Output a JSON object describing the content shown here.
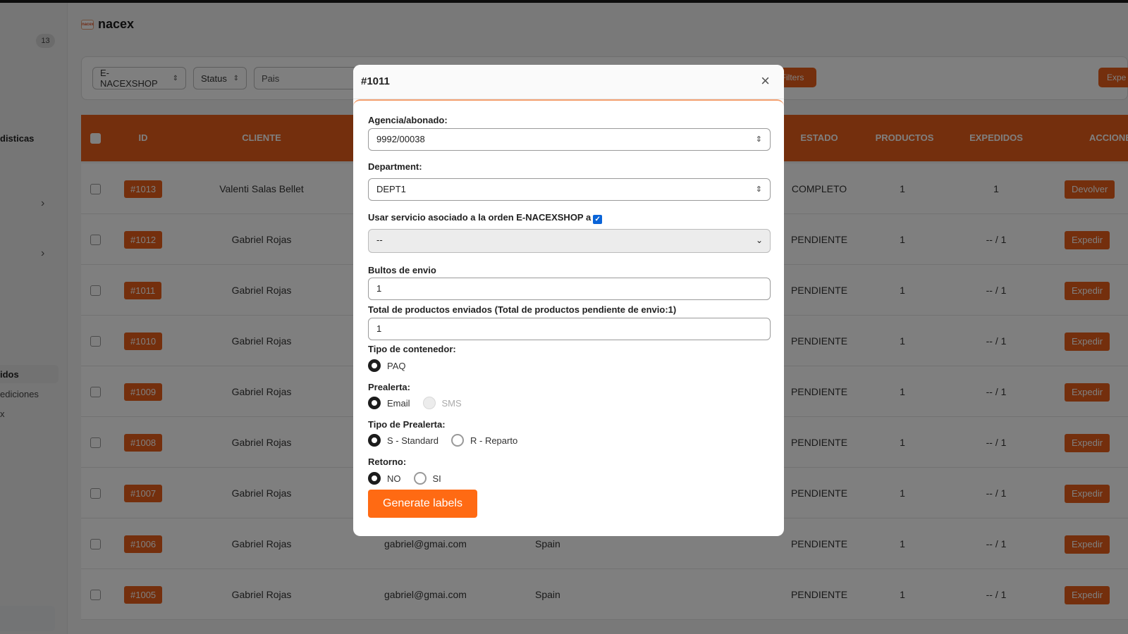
{
  "sidebar": {
    "badge": "13",
    "item_estadisticas": "disticas",
    "item_pedidos": "idos",
    "item_expediciones": "ediciones",
    "item_nacex": "x",
    "chevron": "›"
  },
  "header": {
    "logo_text": "nacex",
    "logo_mark": "nacex"
  },
  "filters": {
    "shop_select": "E-NACEXSHOP",
    "status_select": "Status",
    "country_placeholder": "Pais",
    "filters_button": "Filters",
    "expedir_button": "Expe"
  },
  "table": {
    "columns": {
      "id": "ID",
      "cliente": "CLIENTE",
      "estado": "ESTADO",
      "productos": "PRODUCTOS",
      "expedidos": "EXPEDIDOS",
      "acciones": "ACCIONE"
    },
    "rows": [
      {
        "id": "#1013",
        "cliente": "Valenti Salas Bellet",
        "email": "",
        "pais": "",
        "estado": "COMPLETO",
        "productos": "1",
        "expedidos": "1",
        "accion": "Devolver"
      },
      {
        "id": "#1012",
        "cliente": "Gabriel Rojas",
        "email": "",
        "pais": "",
        "estado": "PENDIENTE",
        "productos": "1",
        "expedidos": "-- / 1",
        "accion": "Expedir"
      },
      {
        "id": "#1011",
        "cliente": "Gabriel Rojas",
        "email": "",
        "pais": "",
        "estado": "PENDIENTE",
        "productos": "1",
        "expedidos": "-- / 1",
        "accion": "Expedir"
      },
      {
        "id": "#1010",
        "cliente": "Gabriel Rojas",
        "email": "",
        "pais": "",
        "estado": "PENDIENTE",
        "productos": "1",
        "expedidos": "-- / 1",
        "accion": "Expedir"
      },
      {
        "id": "#1009",
        "cliente": "Gabriel Rojas",
        "email": "",
        "pais": "",
        "estado": "PENDIENTE",
        "productos": "1",
        "expedidos": "-- / 1",
        "accion": "Expedir"
      },
      {
        "id": "#1008",
        "cliente": "Gabriel Rojas",
        "email": "",
        "pais": "",
        "estado": "PENDIENTE",
        "productos": "1",
        "expedidos": "-- / 1",
        "accion": "Expedir"
      },
      {
        "id": "#1007",
        "cliente": "Gabriel Rojas",
        "email": "",
        "pais": "",
        "estado": "PENDIENTE",
        "productos": "1",
        "expedidos": "-- / 1",
        "accion": "Expedir"
      },
      {
        "id": "#1006",
        "cliente": "Gabriel Rojas",
        "email": "gabriel@gmai.com",
        "pais": "Spain",
        "estado": "PENDIENTE",
        "productos": "1",
        "expedidos": "-- / 1",
        "accion": "Expedir"
      },
      {
        "id": "#1005",
        "cliente": "Gabriel Rojas",
        "email": "gabriel@gmai.com",
        "pais": "Spain",
        "estado": "PENDIENTE",
        "productos": "1",
        "expedidos": "-- / 1",
        "accion": "Expedir"
      }
    ]
  },
  "modal": {
    "title": "#1011",
    "close": "×",
    "agencia_label": "Agencia/abonado:",
    "agencia_value": "9992/00038",
    "department_label": "Department:",
    "department_value": "DEPT1",
    "servicio_label": "Usar servicio asociado a la orden E-NACEXSHOP a",
    "servicio_select": "--",
    "bultos_label": "Bultos de envio",
    "bultos_value": "1",
    "total_label": "Total de productos enviados (Total de productos pendiente de envio:1)",
    "total_value": "1",
    "contenedor_label": "Tipo de contenedor:",
    "contenedor_option": "PAQ",
    "prealerta_label": "Prealerta:",
    "prealerta_email": "Email",
    "prealerta_sms": "SMS",
    "tipo_prealerta_label": "Tipo de Prealerta:",
    "tipo_standard": "S - Standard",
    "tipo_reparto": "R - Reparto",
    "retorno_label": "Retorno:",
    "retorno_no": "NO",
    "retorno_si": "SI",
    "generate_button": "Generate labels"
  },
  "colors": {
    "accent": "#e95f1a",
    "button": "#ff6a13",
    "checkbox": "#0a64d8"
  }
}
